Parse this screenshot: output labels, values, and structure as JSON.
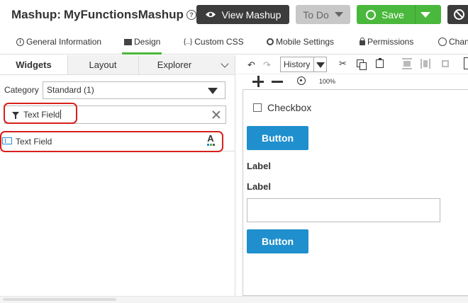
{
  "header": {
    "title_prefix": "Mashup:",
    "title_name": "MyFunctionsMashup",
    "help_icon": "?",
    "view_mashup_label": "View Mashup",
    "todo_label": "To Do",
    "save_label": "Save"
  },
  "tabs": [
    {
      "label": "General Information",
      "icon": "info-icon"
    },
    {
      "label": "Design",
      "icon": "design-icon",
      "active": true
    },
    {
      "label": "Custom CSS",
      "icon": "css-icon",
      "glyph": "{..}"
    },
    {
      "label": "Mobile Settings",
      "icon": "gear-icon"
    },
    {
      "label": "Permissions",
      "icon": "lock-icon"
    },
    {
      "label": "Chan",
      "icon": "clock-icon"
    }
  ],
  "left_panel": {
    "tabs": [
      "Widgets",
      "Layout",
      "Explorer"
    ],
    "category_label": "Category",
    "category_value": "Standard (1)",
    "filter_value": "Text Field",
    "widget_label": "Text Field",
    "widget_badge": "A"
  },
  "toolbar": {
    "undo_glyph": "↶",
    "redo_glyph": "↷",
    "history_label": "History",
    "cut_glyph": "✂",
    "zoom_level": "100%"
  },
  "canvas": {
    "checkbox_label": "Checkbox",
    "button1_label": "Button",
    "label1": "Label",
    "label2": "Label",
    "button2_label": "Button"
  },
  "colors": {
    "accent_green": "#4ab83c",
    "dark_button": "#3c3c3c",
    "canvas_button": "#1f8fcd",
    "highlight_red": "#d9201c"
  }
}
